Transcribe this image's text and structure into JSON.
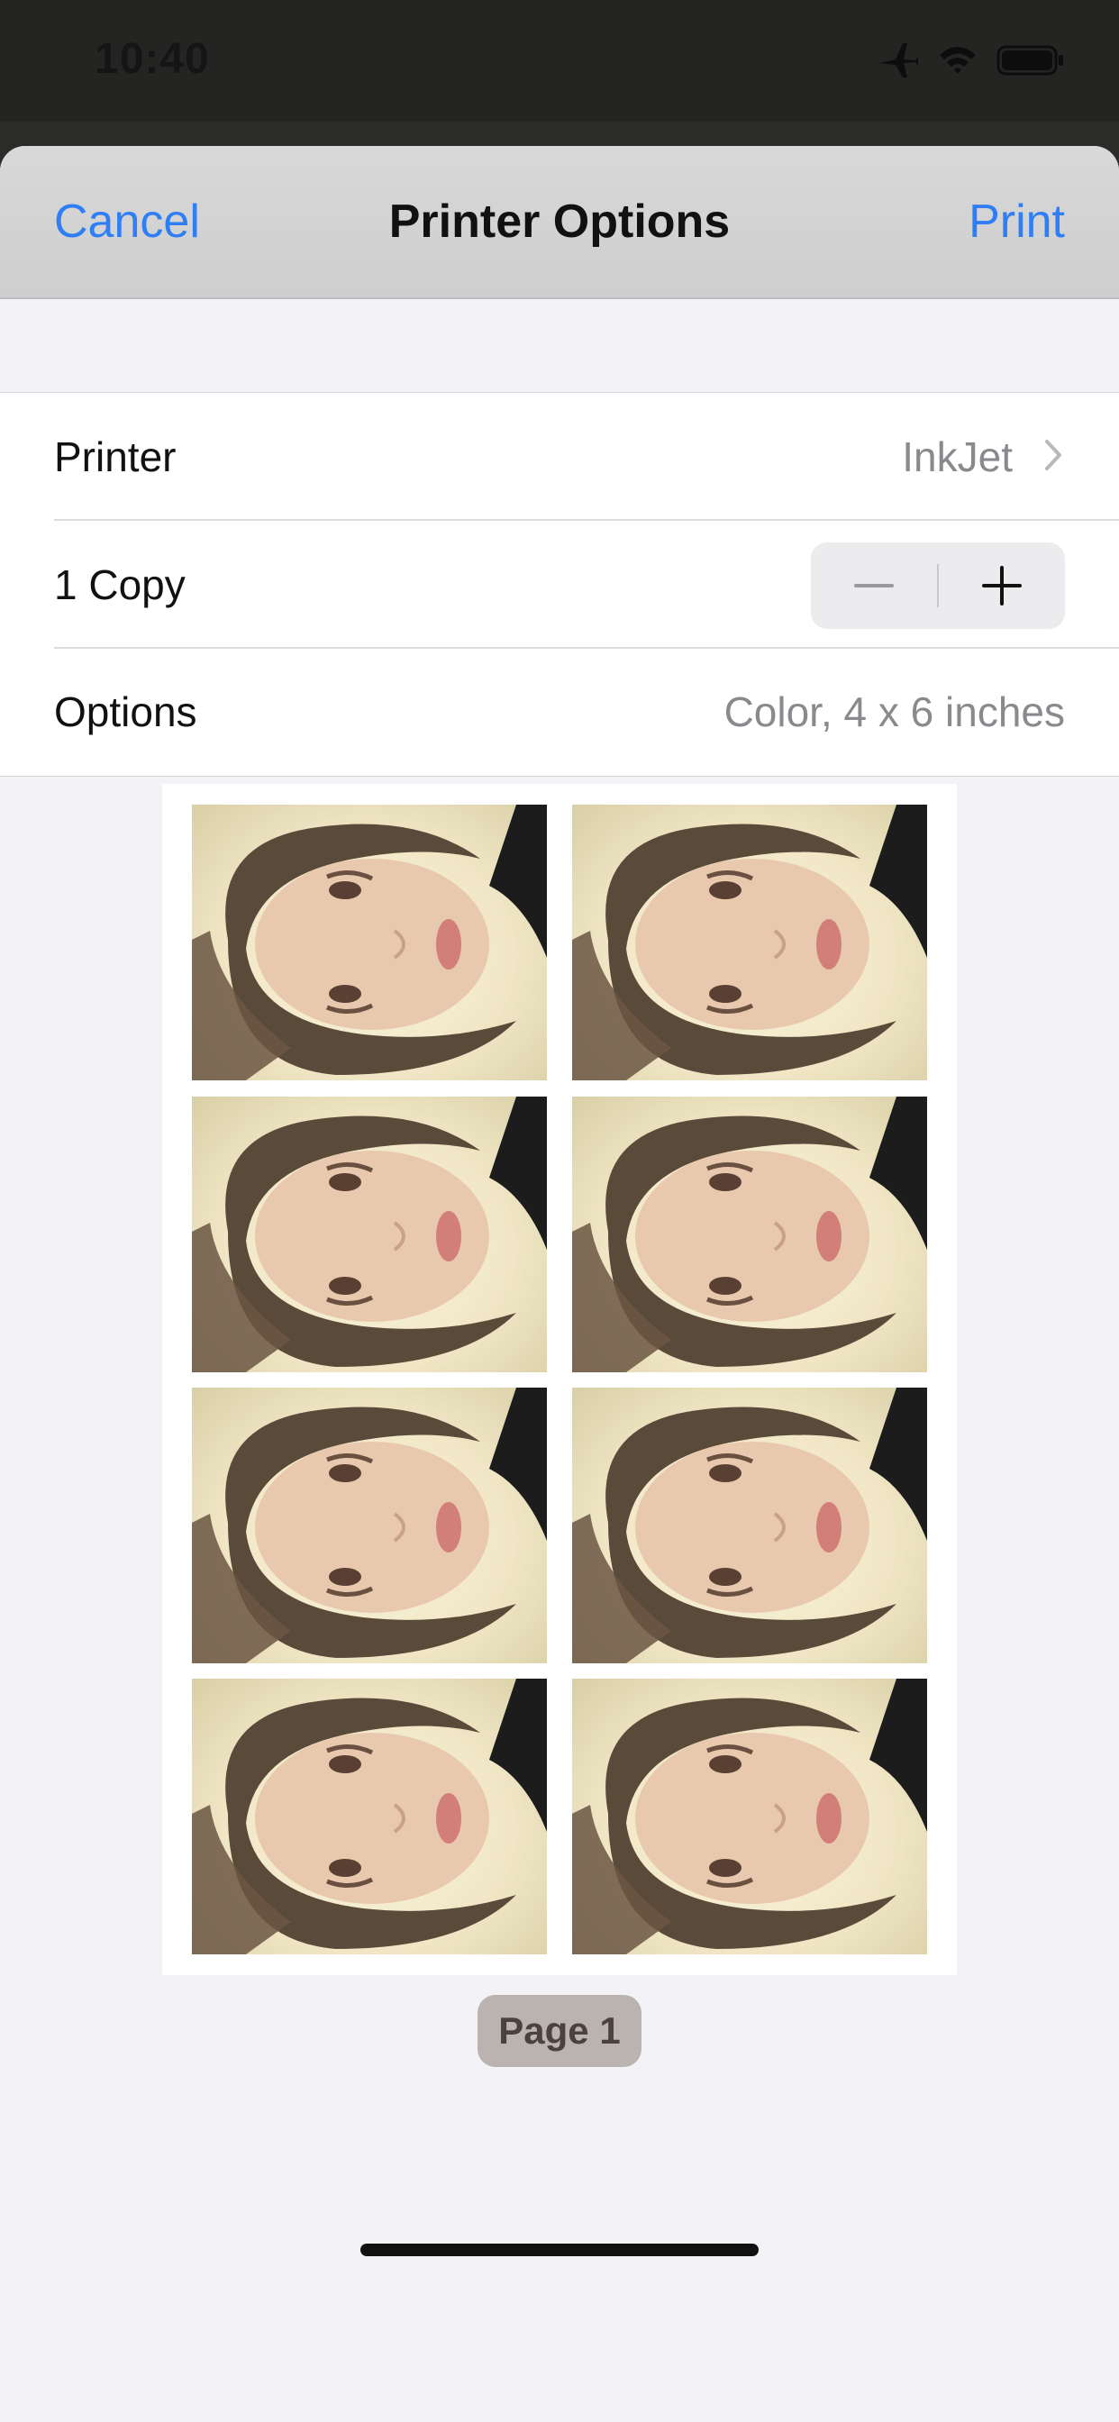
{
  "status_bar": {
    "time": "10:40",
    "icons": [
      "airplane-icon",
      "wifi-icon",
      "battery-icon"
    ]
  },
  "nav": {
    "cancel_label": "Cancel",
    "title": "Printer Options",
    "print_label": "Print"
  },
  "settings": {
    "printer": {
      "label": "Printer",
      "value": "InkJet"
    },
    "copies": {
      "label": "1 Copy"
    },
    "options": {
      "label": "Options",
      "value": "Color, 4 x 6 inches"
    }
  },
  "preview": {
    "page_badge": "Page 1",
    "photo_count": 8
  },
  "colors": {
    "accent": "#2f7ef6",
    "background": "#f2f2f7",
    "secondary_text": "#8a8a8e"
  }
}
